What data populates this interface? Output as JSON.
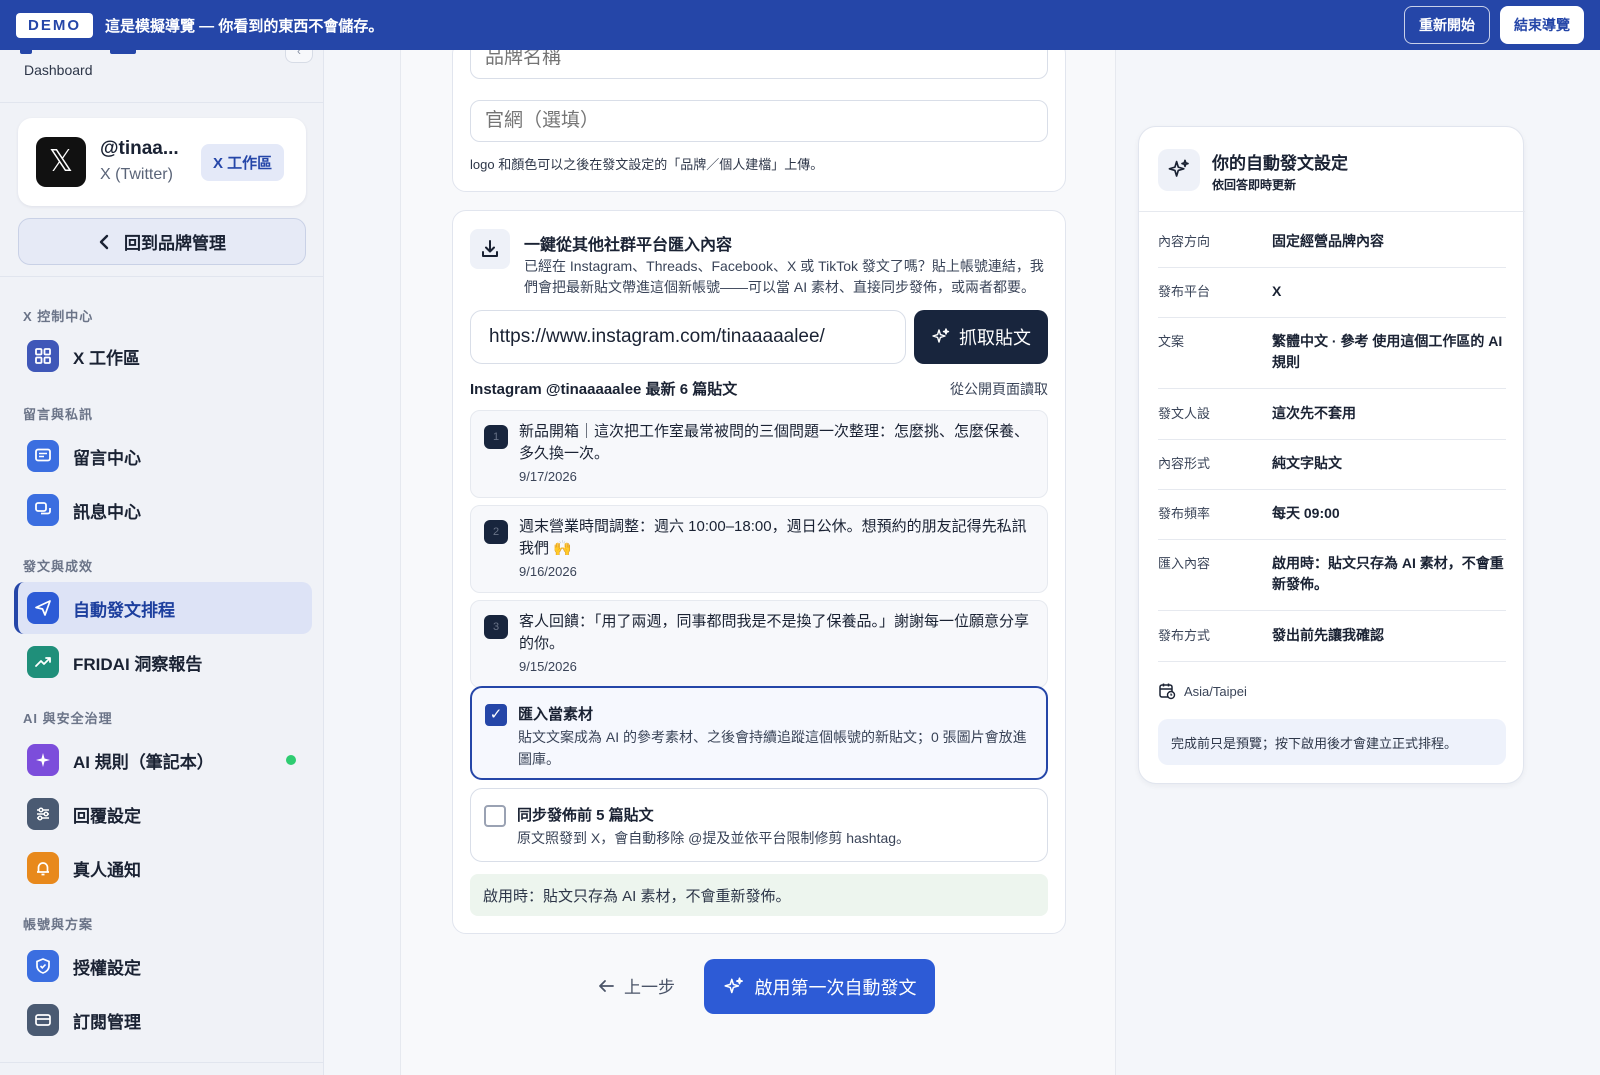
{
  "demo": {
    "badge": "DEMO",
    "text": "這是模擬導覽 — 你看到的東西不會儲存。",
    "restart": "重新開始",
    "end": "結束導覽"
  },
  "sidebar": {
    "dashboard": "Dashboard",
    "account": {
      "handle": "@tinaa...",
      "platform": "X (Twitter)",
      "chip": "X 工作區",
      "logo": "𝕏"
    },
    "back": "回到品牌管理",
    "sections": {
      "control": "X 控制中心",
      "messages": "留言與私訊",
      "posting": "發文與成效",
      "ai": "AI 與安全治理",
      "account": "帳號與方案"
    },
    "items": {
      "workspace": "X 工作區",
      "comments": "留言中心",
      "inbox": "訊息中心",
      "autopost": "自動發文排程",
      "report": "FRIDAI 洞察報告",
      "ai_rules": "AI 規則（筆記本）",
      "reply": "回覆設定",
      "notify": "真人通知",
      "auth": "授權設定",
      "billing": "訂閱管理"
    },
    "colors": {
      "accent": "#2546a8",
      "purple": "#7c4ddb",
      "teal": "#1f8f7a",
      "slate": "#4a5a72",
      "orange": "#e8891c",
      "blue": "#3b6ee0",
      "green": "#2ecc71"
    }
  },
  "form": {
    "brand_placeholder": "品牌名稱",
    "site_placeholder": "官網（選填）",
    "logo_hint": "logo 和顏色可以之後在發文設定的「品牌／個人建檔」上傳。"
  },
  "import": {
    "title": "一鍵從其他社群平台匯入內容",
    "desc": "已經在 Instagram、Threads、Facebook、X 或 TikTok 發文了嗎？貼上帳號連結，我們會把最新貼文帶進這個新帳號——可以當 AI 素材、直接同步發佈，或兩者都要。",
    "url": "https://www.instagram.com/tinaaaaalee/",
    "fetch": "抓取貼文",
    "posts_head": "Instagram @tinaaaaalee 最新 6 篇貼文",
    "posts_src": "從公開頁面讀取",
    "posts": [
      {
        "num": "1",
        "text": "新品開箱｜這次把工作室最常被問的三個問題一次整理：怎麼挑、怎麼保養、多久換一次。",
        "date": "9/17/2026"
      },
      {
        "num": "2",
        "text": "週末營業時間調整：週六 10:00–18:00，週日公休。想預約的朋友記得先私訊我們 🙌",
        "date": "9/16/2026"
      },
      {
        "num": "3",
        "text": "客人回饋：「用了兩週，同事都問我是不是換了保養品。」謝謝每一位願意分享的你。",
        "date": "9/15/2026"
      }
    ],
    "opt_material": {
      "title": "匯入當素材",
      "desc": "貼文文案成為 AI 的參考素材、之後會持續追蹤這個帳號的新貼文；0 張圖片會放進圖庫。",
      "checked": true
    },
    "opt_sync": {
      "title": "同步發佈前 5 篇貼文",
      "desc": "原文照發到 X，會自動移除 @提及並依平台限制修剪 hashtag。",
      "checked": false
    },
    "note": "啟用時：貼文只存為 AI 素材，不會重新發佈。"
  },
  "footer": {
    "prev": "上一步",
    "start": "啟用第一次自動發文"
  },
  "settings": {
    "title": "你的自動發文設定",
    "subtitle": "依回答即時更新",
    "rows": [
      {
        "k": "內容方向",
        "v": "固定經營品牌內容"
      },
      {
        "k": "發布平台",
        "v": "X"
      },
      {
        "k": "文案",
        "v": "繁體中文 · 參考 使用這個工作區的 AI 規則"
      },
      {
        "k": "發文人設",
        "v": "這次先不套用"
      },
      {
        "k": "內容形式",
        "v": "純文字貼文"
      },
      {
        "k": "發布頻率",
        "v": "每天 09:00"
      },
      {
        "k": "匯入內容",
        "v": "啟用時：貼文只存為 AI 素材，不會重新發佈。"
      },
      {
        "k": "發布方式",
        "v": "發出前先讓我確認"
      }
    ],
    "timezone": "Asia/Taipei",
    "note": "完成前只是預覽；按下啟用後才會建立正式排程。"
  }
}
